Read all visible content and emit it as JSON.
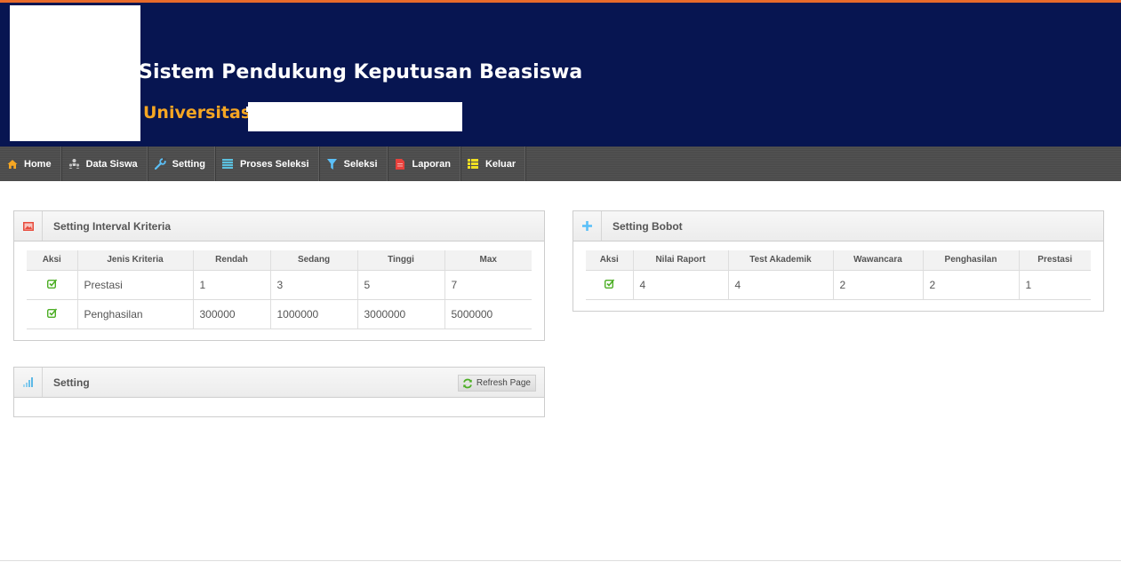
{
  "header": {
    "title": "Sistem Pendukung Keputusan Beasiswa",
    "university_label": "Universitas"
  },
  "nav": {
    "items": [
      {
        "label": "Home",
        "icon": "home-icon",
        "color": "#f5a623"
      },
      {
        "label": "Data Siswa",
        "icon": "users-icon",
        "color": "#cfcfcf"
      },
      {
        "label": "Setting",
        "icon": "wrench-icon",
        "color": "#5bc0f8"
      },
      {
        "label": "Proses Seleksi",
        "icon": "list-icon",
        "color": "#5bc0de"
      },
      {
        "label": "Seleksi",
        "icon": "filter-icon",
        "color": "#5bc0f8"
      },
      {
        "label": "Laporan",
        "icon": "report-icon",
        "color": "#e8413c"
      },
      {
        "label": "Keluar",
        "icon": "list-yellow-icon",
        "color": "#f0e022"
      }
    ]
  },
  "interval_panel": {
    "title": "Setting Interval Kriteria",
    "columns": [
      "Aksi",
      "Jenis Kriteria",
      "Rendah",
      "Sedang",
      "Tinggi",
      "Max"
    ],
    "rows": [
      {
        "jenis": "Prestasi",
        "rendah": "1",
        "sedang": "3",
        "tinggi": "5",
        "max": "7"
      },
      {
        "jenis": "Penghasilan",
        "rendah": "300000",
        "sedang": "1000000",
        "tinggi": "3000000",
        "max": "5000000"
      }
    ]
  },
  "setting_panel": {
    "title": "Setting",
    "refresh_label": "Refresh Page"
  },
  "bobot_panel": {
    "title": "Setting Bobot",
    "columns": [
      "Aksi",
      "Nilai Raport",
      "Test Akademik",
      "Wawancara",
      "Penghasilan",
      "Prestasi"
    ],
    "rows": [
      {
        "nilai_raport": "4",
        "test_akademik": "4",
        "wawancara": "2",
        "penghasilan": "2",
        "prestasi": "1"
      }
    ]
  },
  "colors": {
    "header_bg": "#071551",
    "accent_orange": "#e86a2b",
    "university_text": "#f5a623",
    "edit_icon": "#4cae24"
  }
}
